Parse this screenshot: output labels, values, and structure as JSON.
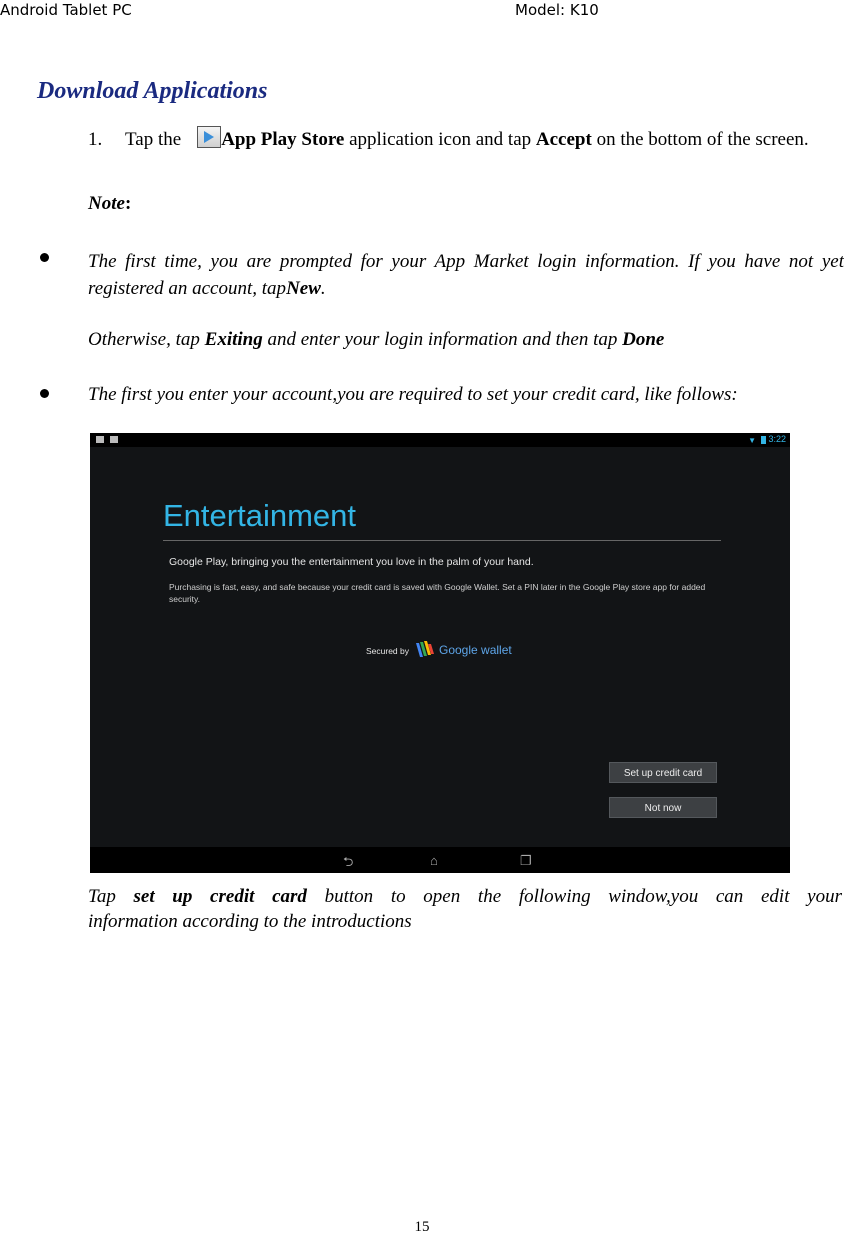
{
  "header": {
    "left": "Android Tablet PC",
    "right": "Model: K10"
  },
  "title": "Download Applications",
  "step1": {
    "number": "1.",
    "prefix": "Tap the",
    "app_name": "App Play Store",
    "middle": " application icon and tap ",
    "accept": "Accept",
    "suffix": " on the bottom of the screen."
  },
  "note_label": "Note",
  "note_colon": ":",
  "bullets": {
    "b1_text": "The first time, you are prompted for your App Market login information. If you have not yet registered an account, tap",
    "b1_bold": "New",
    "b1_end": ".",
    "otherwise_prefix": "Otherwise, tap ",
    "otherwise_bold": "Exiting",
    "otherwise_middle": " and enter your login information and then tap ",
    "otherwise_done": "Done",
    "b2_text": "The first you enter your account,you are required to set your credit card, like follows:"
  },
  "screenshot": {
    "time": "3:22",
    "title": "Entertainment",
    "lead": "Google Play, bringing you the entertainment you love in the palm of your hand.",
    "desc": "Purchasing is fast, easy, and safe because your credit card is saved with Google Wallet. Set a PIN later in the Google Play store app for added security.",
    "secured_by": "Secured by",
    "wallet": "Google wallet",
    "btn_setup": "Set up credit card",
    "btn_notnow": "Not now",
    "nav_icons": [
      "back-icon",
      "home-icon",
      "recents-icon"
    ]
  },
  "caption": {
    "prefix": "Tap ",
    "bold": "set up credit card",
    "rest_line1": " button to open the following window,you can edit your",
    "line2": "information according to the introductions"
  },
  "page_number": "15",
  "colors": {
    "title": "#1a2a80",
    "accent": "#33b5e5"
  }
}
